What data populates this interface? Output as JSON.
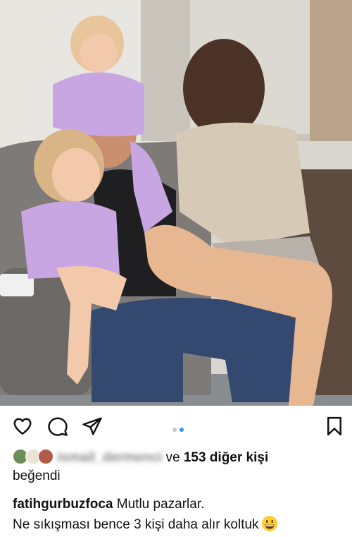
{
  "post": {
    "image_description_alt": "",
    "carousel": {
      "count": 2,
      "active_index": 1
    },
    "colors": {
      "dot_active": "#3897f0",
      "dot_inactive": "#c7c7c7"
    }
  },
  "actions": {
    "like_icon": "heart-icon",
    "comment_icon": "comment-icon",
    "share_icon": "paper-plane-icon",
    "save_icon": "bookmark-icon"
  },
  "likes": {
    "liker_name": "ismail_dermenci",
    "connector": " ve ",
    "others": "153 diğer kişi",
    "suffix": "beğendi"
  },
  "caption": {
    "username": "fatihgurbuzfoca",
    "line1": " Mutlu pazarlar.",
    "line2": "Ne sıkışması bence 3 kişi daha alır koltuk"
  }
}
